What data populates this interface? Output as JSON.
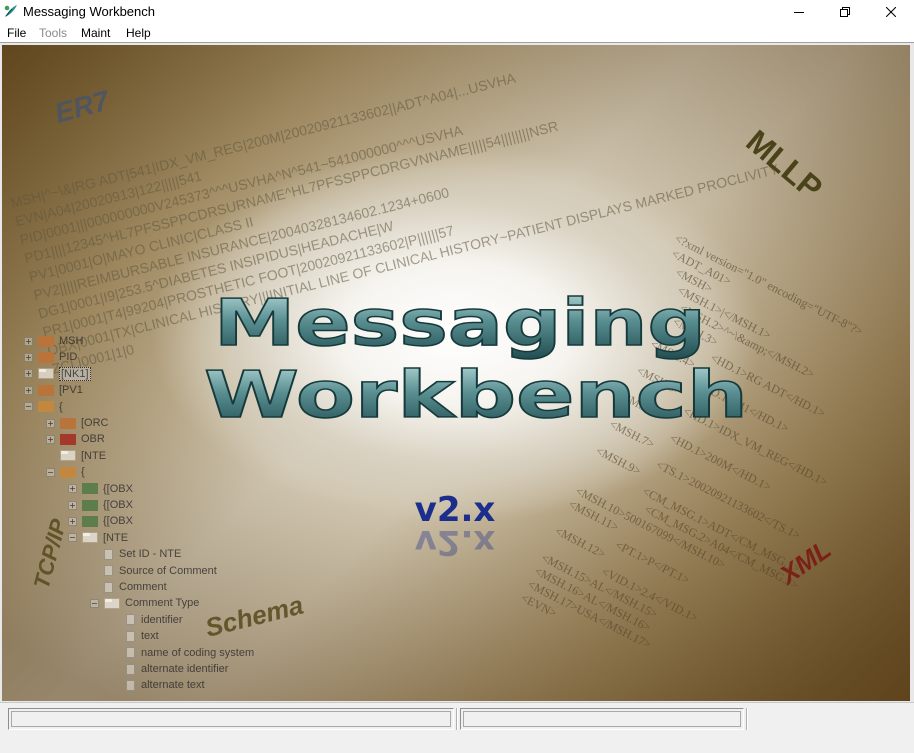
{
  "window": {
    "title": "Messaging Workbench",
    "icon": "app-feather-icon"
  },
  "menu": [
    {
      "label": "File",
      "enabled": true
    },
    {
      "label": "Tools",
      "enabled": false
    },
    {
      "label": "Maint",
      "enabled": true
    },
    {
      "label": "Help",
      "enabled": true
    }
  ],
  "splash": {
    "title_line1": "Messaging",
    "title_line2": "Workbench",
    "version": "v2.x",
    "labels": {
      "er7": "ER7",
      "mllp": "MLLP",
      "xml": "XML",
      "tcpip": "TCP/IP",
      "schema": "Schema"
    },
    "er7_lines": [
      "MSH|^~\\&|RG ADT|541|IDX_VM_REG|200M|20020921133602||ADT^A04|...USVHA",
      "EVN|A04|20020913|122|||||541",
      "PID|0001|||000000000V245373^^^USVHA^N^541~541000000^^^USVHA",
      "PD1||||12345^HL7PFSSPPCDRSURNAME^HL7PFSSPPCDRGVNNAME|||||54||||||||NSR",
      "PV1|0001|O|MAYO CLINIC|CLASS II",
      "PV2|||||REIMBURSABLE INSURANCE|20040328134602.1234+0600",
      "DG1|0001|I9|253.5^DIABETES INSIPIDUS|HEADACHE|W",
      "PR1|0001|T4|99204|PROSTHETIC FOOT|20020921133602|P||||||57",
      "OBX|0001|TX|CLINICAL HISTORY|||INITIAL LINE OF CLINICAL HISTORY~PATIENT DISPLAYS MARKED PROCLIVITY",
      "ZCL|0001|1|0"
    ],
    "xml_lines": [
      "<?xml version=\"1.0\" encoding=\"UTF-8\"?>",
      "<ADT_A01>",
      "<MSH>",
      "<MSH.1>|</MSH.1>",
      "<MSH.2>^~\\&amp;</MSH.2>",
      "<MSH.3>",
      "<HD.1>RG ADT</HD.1>",
      "<MSH.4>",
      "<HD.1>541</HD.1>",
      "<MSH.5>",
      "<HD.1>IDX_VM_REG</HD.1>",
      "<MSH.6>",
      "<HD.1>200M</HD.1>",
      "<MSH.7>",
      "<TS.1>20020921133602</TS.1>",
      "<MSH.9>",
      "<CM_MSG.1>ADT</CM_MSG.1>",
      "<CM_MSG.2>A04</CM_MSG.2>",
      "<MSH.10>500167099</MSH.10>",
      "<MSH.11>",
      "<PT.1>P</PT.1>",
      "<MSH.12>",
      "<VID.1>2.4</VID.1>",
      "<MSH.15>AL</MSH.15>",
      "<MSH.16>AL</MSH.16>",
      "<MSH.17>USA</MSH.17>",
      "<EVN>"
    ]
  },
  "tree": [
    {
      "label": "MSH",
      "depth": 0,
      "expander": "plus",
      "icon": "folder-orange"
    },
    {
      "label": "PID",
      "depth": 0,
      "expander": "plus",
      "icon": "folder-orange"
    },
    {
      "label": "[NK1]",
      "depth": 0,
      "expander": "plus",
      "icon": "folder-white",
      "selected": true
    },
    {
      "label": "[PV1",
      "depth": 0,
      "expander": "plus",
      "icon": "folder-orange"
    },
    {
      "label": "{",
      "depth": 0,
      "expander": "minus",
      "icon": "folder-open"
    },
    {
      "label": "[ORC",
      "depth": 1,
      "expander": "plus",
      "icon": "folder-orange"
    },
    {
      "label": "OBR",
      "depth": 1,
      "expander": "plus",
      "icon": "folder-red"
    },
    {
      "label": "[NTE",
      "depth": 1,
      "expander": "none",
      "icon": "folder-white"
    },
    {
      "label": "{",
      "depth": 1,
      "expander": "minus",
      "icon": "folder-open"
    },
    {
      "label": "{[OBX",
      "depth": 2,
      "expander": "plus",
      "icon": "folder-green"
    },
    {
      "label": "{[OBX",
      "depth": 2,
      "expander": "plus",
      "icon": "folder-green"
    },
    {
      "label": "{[OBX",
      "depth": 2,
      "expander": "plus",
      "icon": "folder-green"
    },
    {
      "label": "[NTE",
      "depth": 2,
      "expander": "minus",
      "icon": "folder-white"
    },
    {
      "label": "Set ID - NTE",
      "depth": 3,
      "expander": "none",
      "icon": "doc"
    },
    {
      "label": "Source of Comment",
      "depth": 3,
      "expander": "none",
      "icon": "doc"
    },
    {
      "label": "Comment",
      "depth": 3,
      "expander": "none",
      "icon": "doc"
    },
    {
      "label": "Comment Type",
      "depth": 3,
      "expander": "minus",
      "icon": "folder-white"
    },
    {
      "label": "identifier",
      "depth": 4,
      "expander": "none",
      "icon": "doc"
    },
    {
      "label": "text",
      "depth": 4,
      "expander": "none",
      "icon": "doc"
    },
    {
      "label": "name of coding system",
      "depth": 4,
      "expander": "none",
      "icon": "doc"
    },
    {
      "label": "alternate identifier",
      "depth": 4,
      "expander": "none",
      "icon": "doc"
    },
    {
      "label": "alternate text",
      "depth": 4,
      "expander": "none",
      "icon": "doc"
    }
  ],
  "statusbar": {
    "panel1": "",
    "panel2": ""
  },
  "colors": {
    "title_text": "#2c5a5c",
    "version_text": "#1b2e8c",
    "xml_label": "#7a1a14",
    "mllp_label": "#4a4218",
    "schema_label": "#574a1c",
    "er7_label": "#4a5565"
  }
}
